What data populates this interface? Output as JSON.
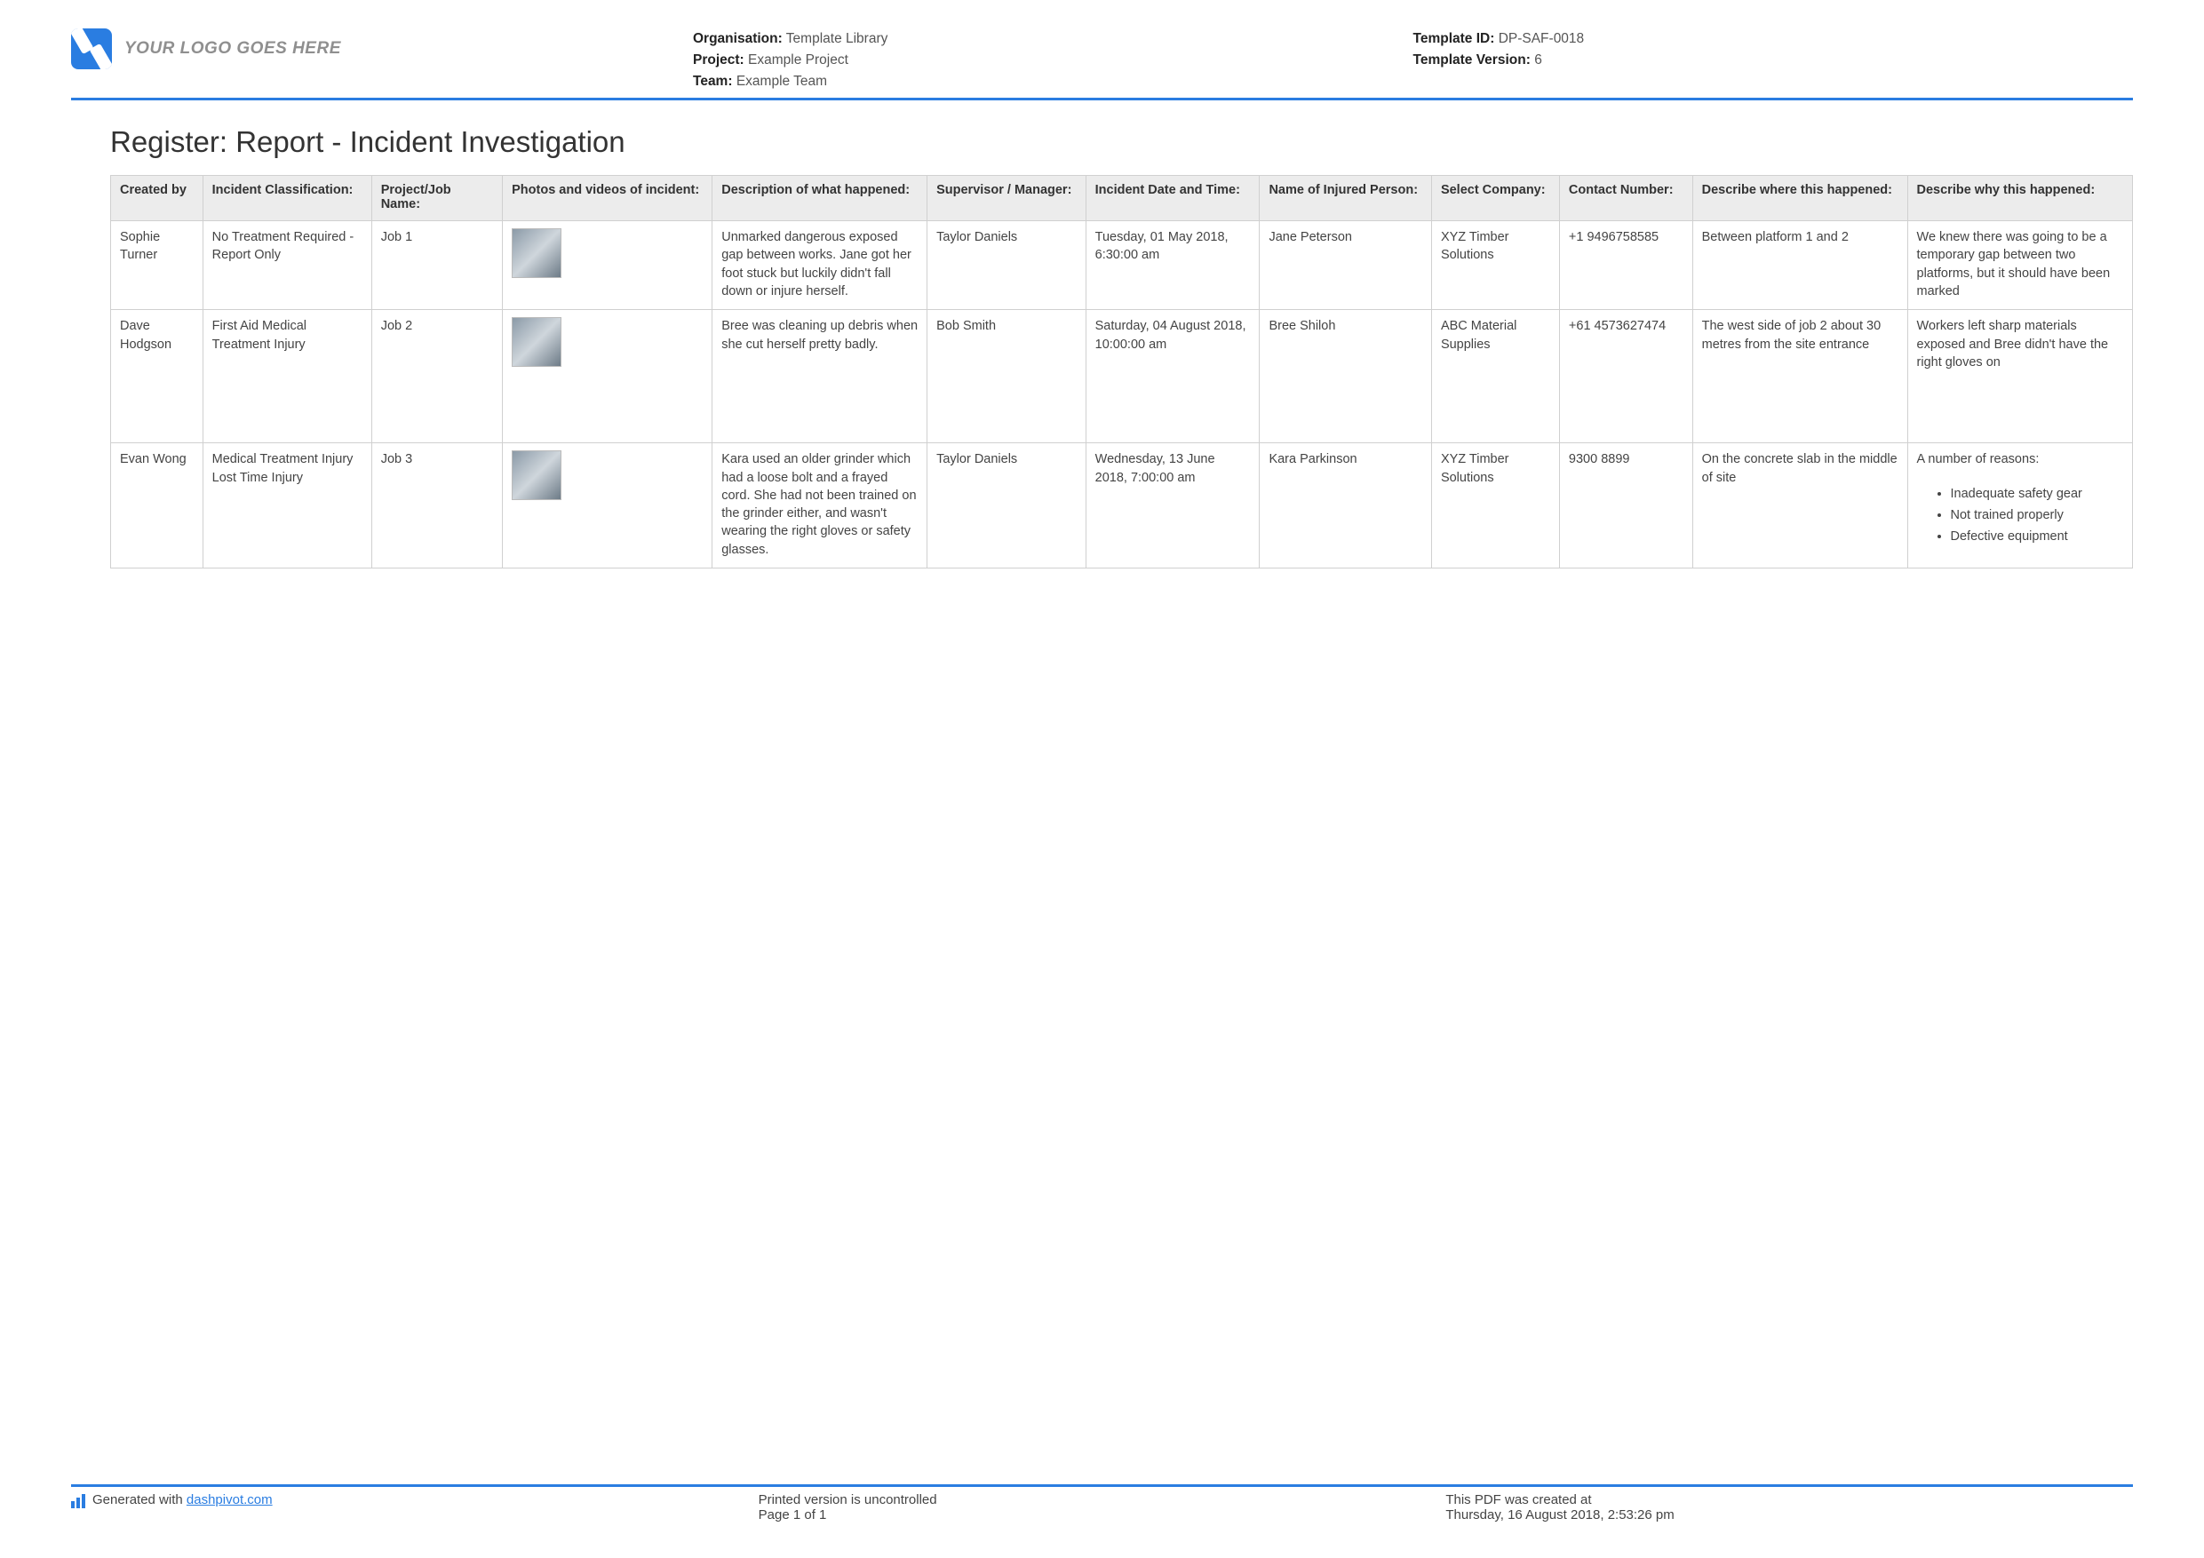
{
  "header": {
    "logo_text": "YOUR LOGO GOES HERE",
    "meta_left": {
      "organisation_label": "Organisation:",
      "organisation_value": "Template Library",
      "project_label": "Project:",
      "project_value": "Example Project",
      "team_label": "Team:",
      "team_value": "Example Team"
    },
    "meta_right": {
      "template_id_label": "Template ID:",
      "template_id_value": "DP-SAF-0018",
      "template_version_label": "Template Version:",
      "template_version_value": "6"
    }
  },
  "title": "Register: Report - Incident Investigation",
  "table": {
    "headers": {
      "created_by": "Created by",
      "classification": "Incident Classification:",
      "project_job": "Project/Job Name:",
      "photos": "Photos and videos of incident:",
      "description": "Description of what happened:",
      "supervisor": "Supervisor / Manager:",
      "datetime": "Incident Date and Time:",
      "injured_name": "Name of Injured Person:",
      "company": "Select Company:",
      "contact": "Contact Number:",
      "where": "Describe where this happened:",
      "why": "Describe why this happened:"
    },
    "rows": [
      {
        "created_by": "Sophie Turner",
        "classification": "No Treatment Required - Report Only",
        "project_job": "Job 1",
        "description": "Unmarked dangerous exposed gap between works. Jane got her foot stuck but luckily didn't fall down or injure herself.",
        "supervisor": "Taylor Daniels",
        "datetime": "Tuesday, 01 May 2018, 6:30:00 am",
        "injured_name": "Jane Peterson",
        "company": "XYZ Timber Solutions",
        "contact": "+1 9496758585",
        "where": "Between platform 1 and 2",
        "why_text": "We knew there was going to be a temporary gap between two platforms, but it should have been marked"
      },
      {
        "created_by": "Dave Hodgson",
        "classification": "First Aid   Medical Treatment Injury",
        "project_job": "Job 2",
        "description": "Bree was cleaning up debris when she cut herself pretty badly.",
        "supervisor": "Bob Smith",
        "datetime": "Saturday, 04 August 2018, 10:00:00 am",
        "injured_name": "Bree Shiloh",
        "company": "ABC Material Supplies",
        "contact": "+61 4573627474",
        "where": "The west side of job 2 about 30 metres from the site entrance",
        "why_text": "Workers left sharp materials exposed and Bree didn't have the right gloves on"
      },
      {
        "created_by": "Evan Wong",
        "classification": "Medical Treatment Injury   Lost Time Injury",
        "project_job": "Job 3",
        "description": "Kara used an older grinder which had a loose bolt and a frayed cord. She had not been trained on the grinder either, and wasn't wearing the right gloves or safety glasses.",
        "supervisor": "Taylor Daniels",
        "datetime": "Wednesday, 13 June 2018, 7:00:00 am",
        "injured_name": "Kara Parkinson",
        "company": "XYZ Timber Solutions",
        "contact": "9300 8899",
        "where": "On the concrete slab in the middle of site",
        "why_text": "A number of reasons:",
        "why_list": [
          "Inadequate safety gear",
          "Not trained properly",
          "Defective equipment"
        ]
      }
    ]
  },
  "footer": {
    "generated_prefix": "Generated with ",
    "generated_link": "dashpivot.com",
    "printed_line": "Printed version is uncontrolled",
    "page_line": "Page 1 of 1",
    "created_line": "This PDF was created at",
    "created_date": "Thursday, 16 August 2018, 2:53:26 pm"
  }
}
